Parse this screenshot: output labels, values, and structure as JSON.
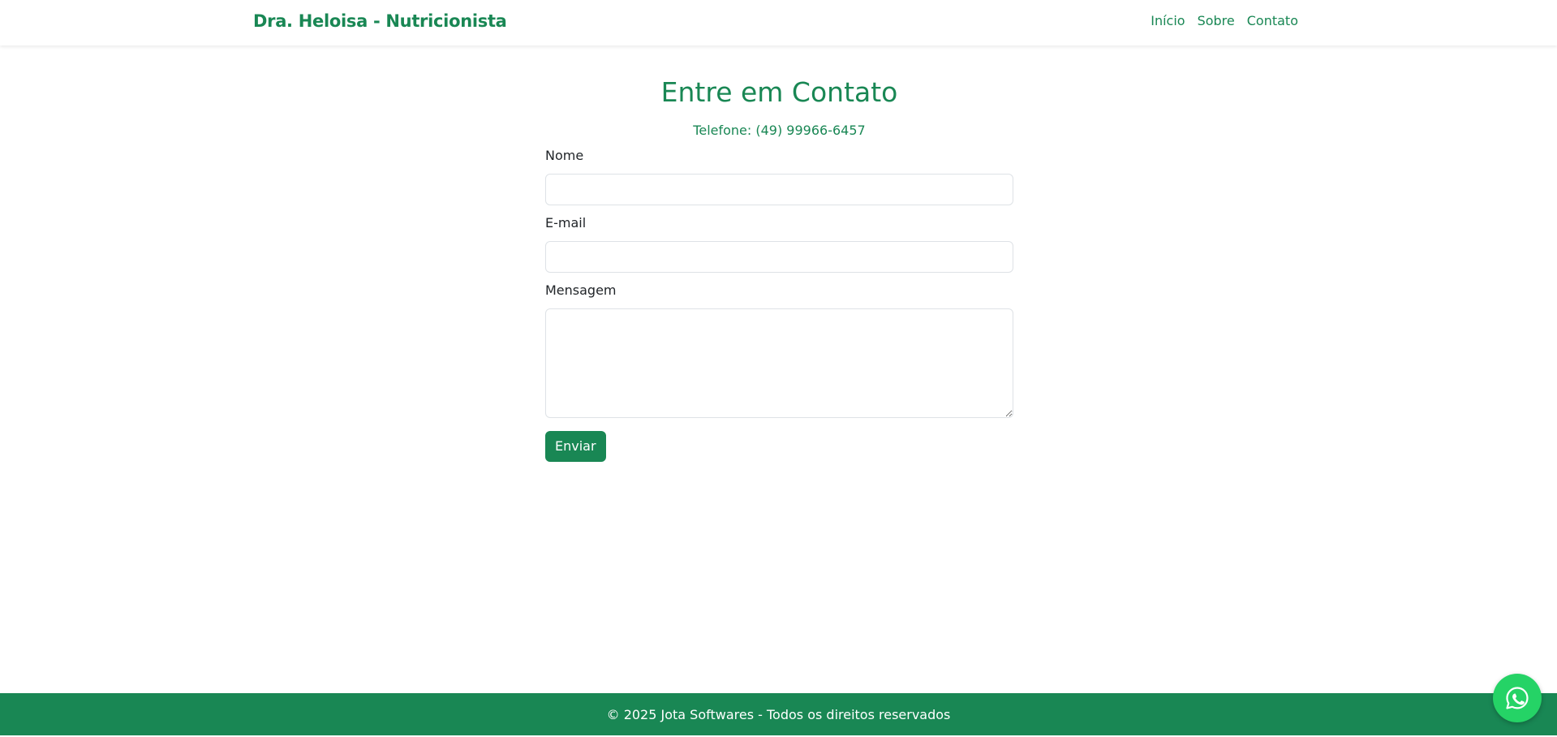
{
  "navbar": {
    "brand": "Dra. Heloisa - Nutricionista",
    "links": [
      "Início",
      "Sobre",
      "Contato"
    ]
  },
  "contact": {
    "title": "Entre em Contato",
    "phone": "Telefone: (49) 99966-6457",
    "form": {
      "name_label": "Nome",
      "name_value": "",
      "email_label": "E-mail",
      "email_value": "",
      "message_label": "Mensagem",
      "message_value": "",
      "submit_label": "Enviar"
    }
  },
  "footer": {
    "text": "© 2025 Jota Softwares - Todos os direitos reservados"
  },
  "floating": {
    "icon": "whatsapp-icon"
  },
  "colors": {
    "brand_green": "#198754",
    "whatsapp_green": "#25d366",
    "text_dark": "#212529",
    "input_border": "#dee2e6"
  }
}
